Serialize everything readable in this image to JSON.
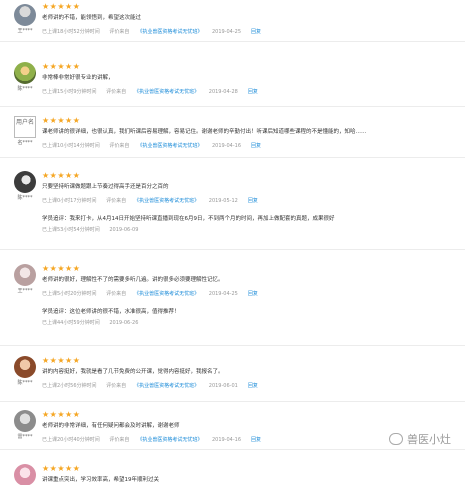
{
  "reviews": [
    {
      "user": "王****",
      "stars": "★★★★★",
      "text": "老师讲的不错，能领悟到，希望这次能过",
      "meta": {
        "studied": "已上课18小时52分钟时间",
        "source": "评价来自",
        "course": "《执业兽医资格考试无忧班》",
        "date": "2019-04-25",
        "reply": "回复"
      }
    },
    {
      "user": "陈****",
      "stars": "★★★★★",
      "text": "非常棒非常好很专业的讲解，",
      "meta": {
        "studied": "已上课15小时9分钟时间",
        "source": "评价来自",
        "course": "《执业兽医资格考试无忧班》",
        "date": "2019-04-28",
        "reply": "回复"
      }
    },
    {
      "user": "名****",
      "avatar_text": "用户名",
      "stars": "★★★★★",
      "text": "课老师讲的很详细，也很认真，我们听课后容易理解，容易记住。谢谢老师的辛勤付出！听课后知道哪些课程的不是懂能的，知哈……",
      "meta": {
        "studied": "已上课10小时14分钟时间",
        "source": "评价来自",
        "course": "《执业兽医资格考试无忧班》",
        "date": "2019-04-16",
        "reply": "回复"
      }
    },
    {
      "user": "陈****",
      "stars": "★★★★★",
      "text": "只要坚持听课做题跟上节奏过得高手还是百分之百的",
      "meta": {
        "studied": "已上课0小时17分钟时间",
        "source": "评价来自",
        "course": "《执业兽医资格考试无忧班》",
        "date": "2019-05-12",
        "reply": "回复"
      },
      "reply": {
        "text": "学员追评：我来打卡，从4月14日开始坚持听课直播到现在6月9日，不到两个月的时间，再加上做配套的真题，成果很好",
        "studied": "已上课53小时54分钟时间",
        "date": "2019-06-09"
      }
    },
    {
      "user": "王****",
      "stars": "★★★★★",
      "text": "老师讲的很好，理解性不了的需要多听几遍。讲的很多必须要理解性记忆。",
      "meta": {
        "studied": "已上课5小时20分钟时间",
        "source": "评价来自",
        "course": "《执业兽医资格考试无忧班》",
        "date": "2019-04-25",
        "reply": "回复"
      },
      "reply": {
        "text": "学员追评：这位老师讲的很不错，水准很高，值得推荐！",
        "studied": "已上课44小时59分钟时间",
        "date": "2019-06-26"
      }
    },
    {
      "user": "陈****",
      "stars": "★★★★★",
      "text": "讲的内容挺好，我就是看了几节免费的公开课，觉得内容挺好，我报名了。",
      "meta": {
        "studied": "已上课2小时56分钟时间",
        "source": "评价来自",
        "course": "《执业兽医资格考试无忧班》",
        "date": "2019-06-01",
        "reply": "回复"
      }
    },
    {
      "user": "雷****",
      "stars": "★★★★★",
      "text": "老师讲的非常详细，有任何疑问都会及时讲解，谢谢老师",
      "meta": {
        "studied": "已上课20小时40分钟时间",
        "source": "评价来自",
        "course": "《执业兽医资格考试无忧班》",
        "date": "2019-04-16",
        "reply": "回复"
      }
    },
    {
      "user": "陈****",
      "stars": "★★★★★",
      "text": "讲课重点突出，学习效率高，希望19年顺利过关",
      "meta": {}
    }
  ],
  "watermark": "兽医小灶",
  "colors": {
    "star": "#f5a623",
    "link": "#1a8bd8",
    "muted": "#999999"
  }
}
